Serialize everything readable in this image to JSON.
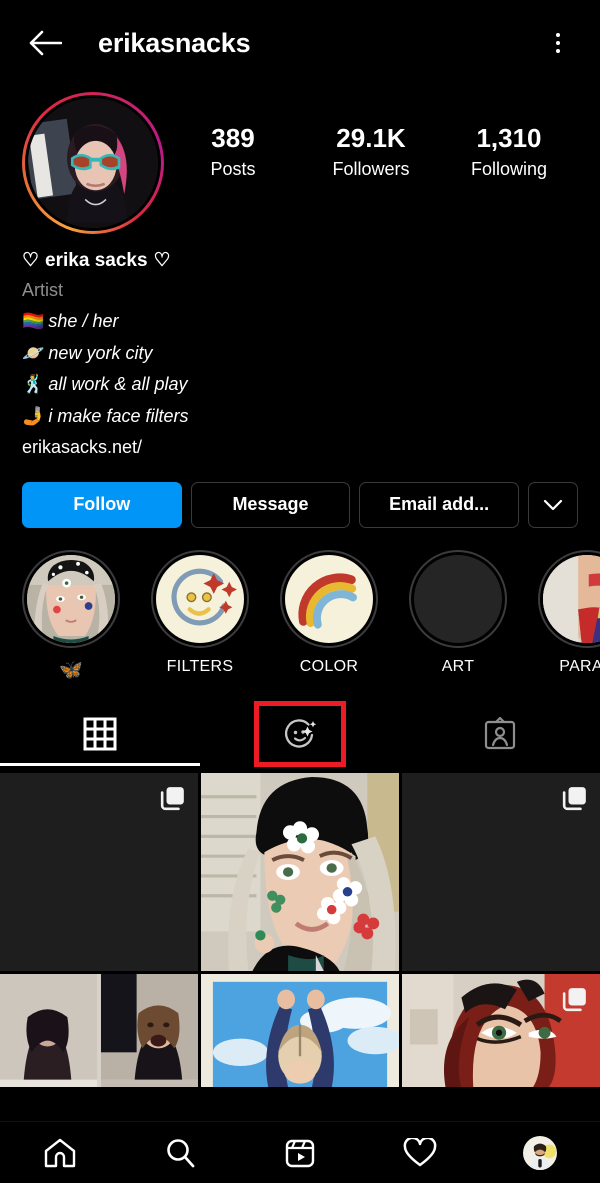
{
  "header": {
    "back_icon": "back-arrow-icon",
    "title": "erikasnacks",
    "menu_icon": "kebab-menu-icon"
  },
  "profile": {
    "avatar_name": "profile-avatar",
    "has_story_ring": true,
    "stats": [
      {
        "number": "389",
        "label": "Posts"
      },
      {
        "number": "29.1K",
        "label": "Followers"
      },
      {
        "number": "1,310",
        "label": "Following"
      }
    ]
  },
  "bio": {
    "display_name": "erika sacks",
    "name_heart_left": "♡",
    "name_heart_right": "♡",
    "category": "Artist",
    "lines": [
      {
        "emoji": "🏳️‍🌈",
        "text": "she / her"
      },
      {
        "emoji": "🪐",
        "text": "new york city"
      },
      {
        "emoji": "🕺",
        "text": "all work & all play"
      },
      {
        "emoji": "🤳",
        "text": "i make face filters"
      }
    ],
    "website": "erikasacks.net/"
  },
  "actions": {
    "follow_label": "Follow",
    "message_label": "Message",
    "email_label": "Email add...",
    "caret_icon": "chevron-down-icon"
  },
  "highlights": [
    {
      "label": "🦋",
      "is_emoji": true,
      "kind": "photo-face",
      "name": "highlight-butterfly"
    },
    {
      "label": "FILTERS",
      "is_emoji": false,
      "kind": "smiley-sparkle",
      "name": "highlight-filters"
    },
    {
      "label": "COLOR",
      "is_emoji": false,
      "kind": "rainbow",
      "name": "highlight-color"
    },
    {
      "label": "ART",
      "is_emoji": false,
      "kind": "dark",
      "name": "highlight-art"
    },
    {
      "label": "PARAD",
      "is_emoji": false,
      "kind": "photo-outfit",
      "name": "highlight-parade"
    }
  ],
  "tabs": [
    {
      "icon": "grid-icon",
      "name": "tab-grid",
      "active": true,
      "highlighted": false
    },
    {
      "icon": "effects-smiley-sparkle-icon",
      "name": "tab-effects",
      "active": false,
      "highlighted": true
    },
    {
      "icon": "tagged-person-icon",
      "name": "tab-tagged",
      "active": false,
      "highlighted": false
    }
  ],
  "highlight_box_color": "#ed1c24",
  "accent_color": "#0095f6",
  "grid": {
    "row1": [
      {
        "name": "post-thumbnail",
        "kind": "dark",
        "carousel": true
      },
      {
        "name": "post-thumbnail",
        "kind": "beret-flowers",
        "carousel": false
      },
      {
        "name": "post-thumbnail",
        "kind": "dark",
        "carousel": true
      }
    ],
    "row2": [
      {
        "name": "post-thumbnail",
        "kind": "video-call",
        "carousel": false
      },
      {
        "name": "post-thumbnail",
        "kind": "sky-arms",
        "carousel": false
      },
      {
        "name": "post-thumbnail",
        "kind": "red-hair",
        "carousel": true
      }
    ]
  },
  "bottom_nav": [
    {
      "icon": "home-icon",
      "name": "nav-home"
    },
    {
      "icon": "search-icon",
      "name": "nav-search"
    },
    {
      "icon": "reels-icon",
      "name": "nav-reels"
    },
    {
      "icon": "heart-activity-icon",
      "name": "nav-activity"
    },
    {
      "icon": "profile-avatar-icon",
      "name": "nav-profile"
    }
  ]
}
